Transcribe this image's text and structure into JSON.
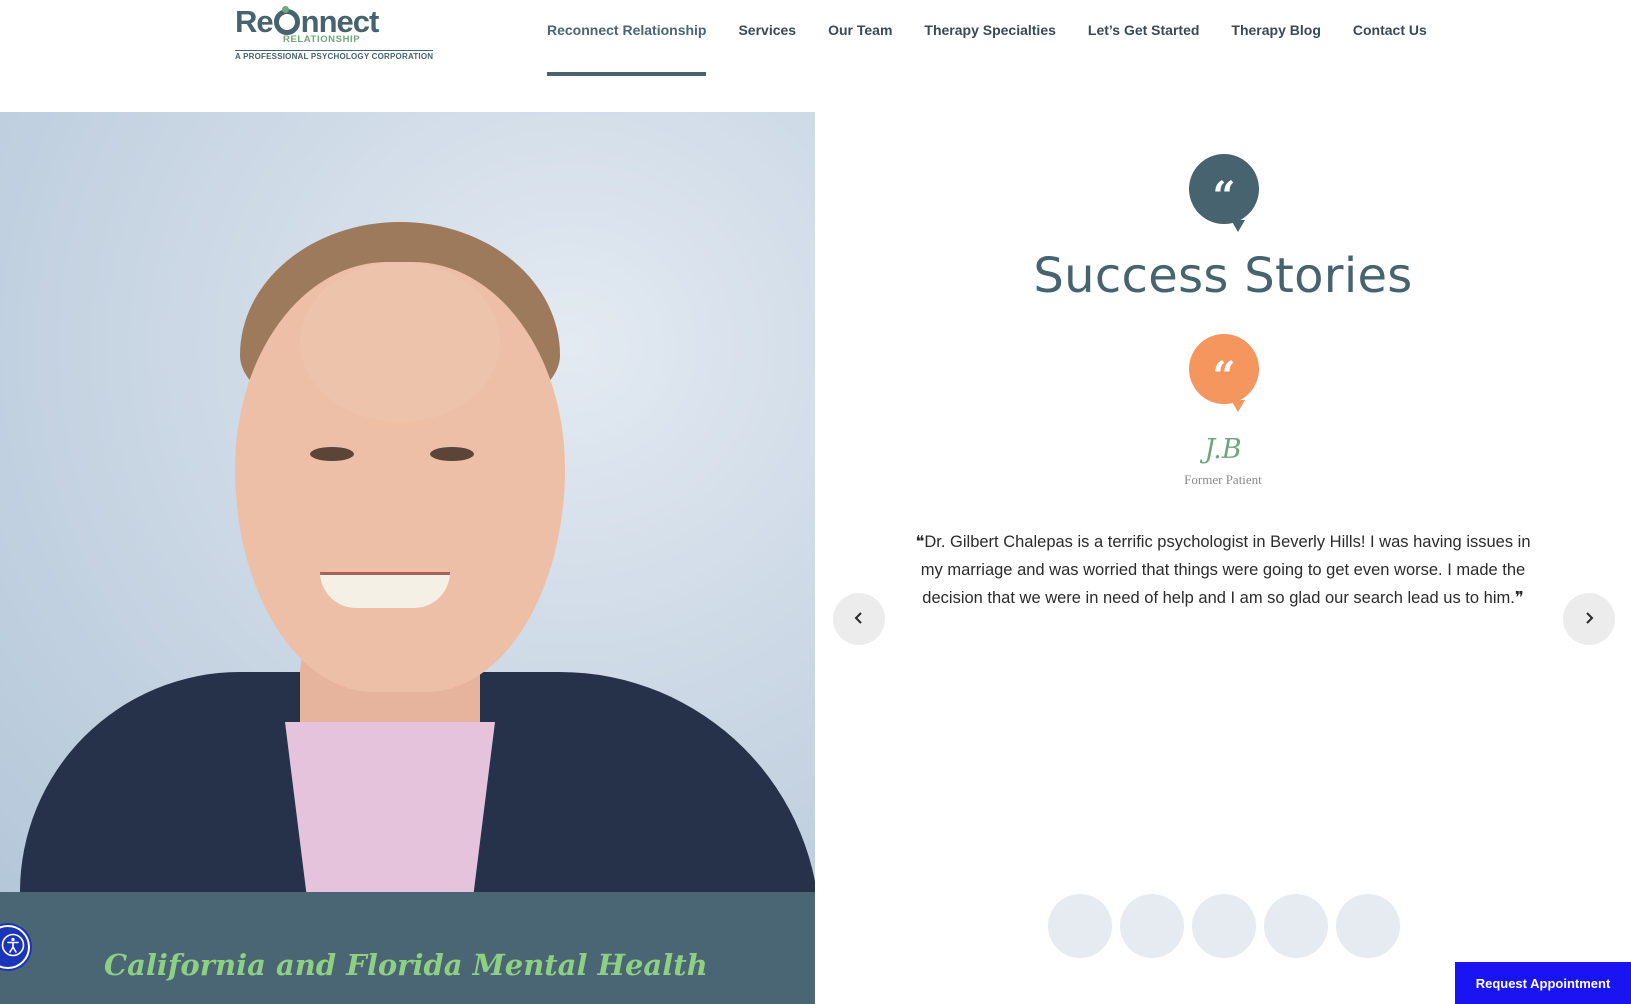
{
  "logo": {
    "main_pre": "Re",
    "main_post": "nnect",
    "sub": "RELATIONSHIP",
    "corp": "A PROFESSIONAL PSYCHOLOGY CORPORATION"
  },
  "nav": {
    "items": [
      {
        "label": "Reconnect Relationship",
        "active": true
      },
      {
        "label": "Services"
      },
      {
        "label": "Our Team"
      },
      {
        "label": "Therapy Specialties"
      },
      {
        "label": "Let’s Get Started"
      },
      {
        "label": "Therapy Blog"
      },
      {
        "label": "Contact Us"
      }
    ]
  },
  "hero": {
    "caption": "California and Florida Mental Health"
  },
  "testimonials": {
    "title": "Success Stories",
    "quote_mark": "“",
    "author": "J.B",
    "author_role": "Former Patient",
    "text": "❝Dr. Gilbert Chalepas is a terrific psychologist in Beverly Hills! I was having issues in my marriage and was worried that things were going to get even worse. I made the decision that we were in need of help and I am so glad our search lead us to him.❞",
    "prev_glyph": "‹",
    "next_glyph": "›",
    "dot_count": 5
  },
  "cta": {
    "label": "Request Appointment"
  },
  "colors": {
    "brand_slate": "#46636f",
    "brand_green": "#6ea77a",
    "accent_orange": "#f4965e",
    "cta_blue": "#1a13f2",
    "accessibility_blue": "#1b35b9"
  },
  "icons": [
    "accessibility-icon",
    "quote-icon",
    "chevron-left-icon",
    "chevron-right-icon"
  ]
}
